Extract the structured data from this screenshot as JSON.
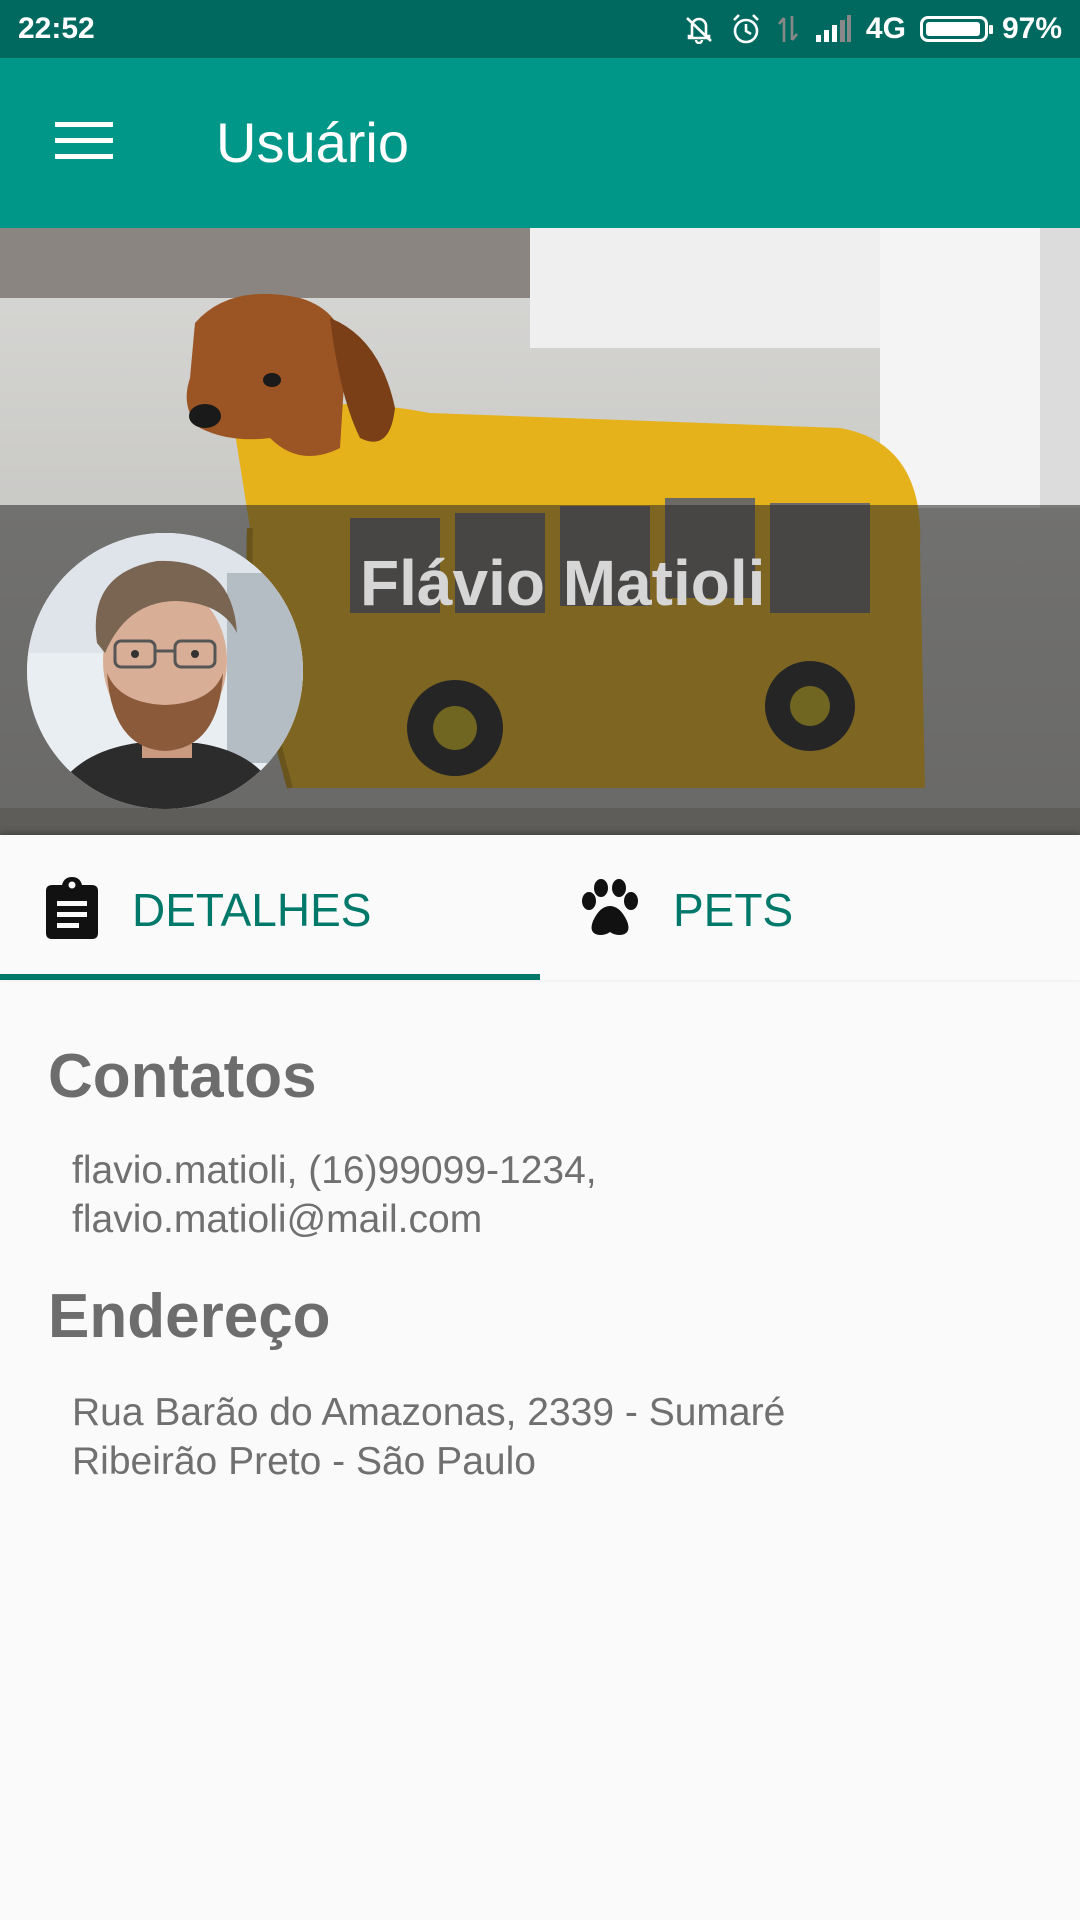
{
  "status_bar": {
    "time": "22:52",
    "network": "4G",
    "battery": "97%",
    "battery_level": 0.97,
    "icons": [
      "vibrate-icon",
      "alarm-icon",
      "data-transfer-icon",
      "signal-icon",
      "battery-icon"
    ]
  },
  "app_bar": {
    "title": "Usuário",
    "menu_icon": "hamburger-menu-icon"
  },
  "profile": {
    "name": "Flávio Matioli"
  },
  "tabs": [
    {
      "label": "DETALHES",
      "icon": "clipboard-icon",
      "selected": true
    },
    {
      "label": "PETS",
      "icon": "paw-icon",
      "selected": false
    }
  ],
  "details": {
    "contacts_title": "Contatos",
    "contacts_line1": "flavio.matioli, (16)99099-1234,",
    "contacts_line2": "flavio.matioli@mail.com",
    "address_title": "Endereço",
    "address_line1": "Rua Barão do Amazonas, 2339 - Sumaré",
    "address_line2": "Ribeirão Preto - São Paulo"
  },
  "colors": {
    "status_bar": "#00695f",
    "app_bar": "#009688",
    "accent": "#00796b",
    "text_gray": "#707070",
    "background": "#fafafa"
  }
}
